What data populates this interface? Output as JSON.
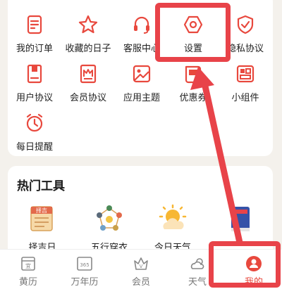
{
  "grid": {
    "items": [
      {
        "label": "我的订单",
        "icon": "order-icon"
      },
      {
        "label": "收藏的日子",
        "icon": "star-icon"
      },
      {
        "label": "客服中心",
        "icon": "headset-icon"
      },
      {
        "label": "设置",
        "icon": "settings-icon"
      },
      {
        "label": "隐私协议",
        "icon": "shield-icon"
      },
      {
        "label": "用户协议",
        "icon": "document-icon"
      },
      {
        "label": "会员协议",
        "icon": "crown-icon"
      },
      {
        "label": "应用主题",
        "icon": "theme-icon"
      },
      {
        "label": "优惠券",
        "icon": "coupon-icon"
      },
      {
        "label": "小组件",
        "icon": "widget-icon"
      },
      {
        "label": "每日提醒",
        "icon": "alarm-icon"
      }
    ]
  },
  "tools": {
    "title": "热门工具",
    "items": [
      {
        "label": "择吉日",
        "icon": "lucky-day-icon",
        "badge": "择吉"
      },
      {
        "label": "五行穿衣",
        "icon": "five-elements-icon"
      },
      {
        "label": "今日天气",
        "icon": "weather-icon"
      },
      {
        "label": "",
        "icon": "book-icon"
      }
    ]
  },
  "tabs": [
    {
      "label": "黄历",
      "icon": "almanac-icon",
      "icon_text": "宜"
    },
    {
      "label": "万年历",
      "icon": "calendar-icon",
      "icon_text": "365"
    },
    {
      "label": "会员",
      "icon": "vip-crown-icon",
      "icon_text": "V"
    },
    {
      "label": "天气",
      "icon": "cloud-sun-icon"
    },
    {
      "label": "我的",
      "icon": "profile-icon",
      "active": true
    }
  ],
  "colors": {
    "accent": "#e8483d",
    "highlight": "#e84349"
  }
}
